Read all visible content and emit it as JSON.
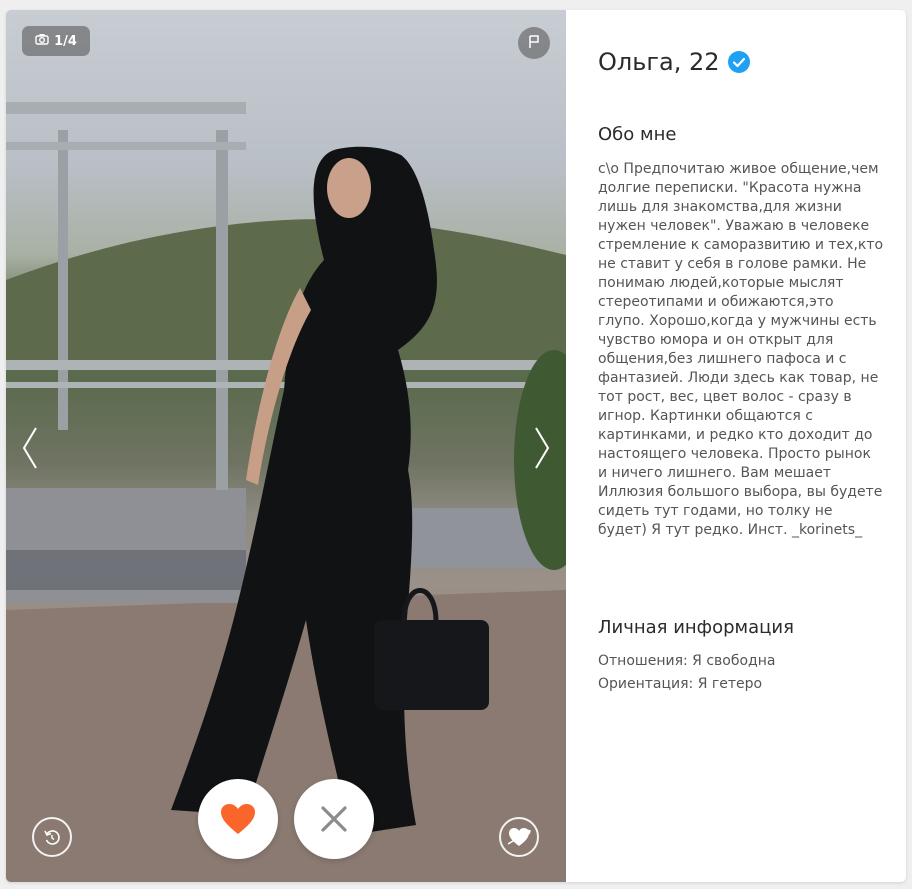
{
  "photo": {
    "counter": "1/4",
    "alt": "Фото профиля"
  },
  "profile": {
    "name_age": "Ольга, 22",
    "verified": true
  },
  "about": {
    "heading": "Обо мне",
    "text": "с\\о Предпочитаю живое общение,чем долгие переписки. \"Красота нужна лишь для знакомства,для жизни нужен человек\". Уважаю в человеке стремление к саморазвитию и тех,кто не ставит у себя в голове рамки. Не понимаю людей,которые мыслят стереотипами и обижаются,это глупо. Хорошо,когда у мужчины есть чувство юмора и он открыт для общения,без лишнего пафоса и с фантазией. Люди здесь как товар, не тот рост, вес, цвет волос - сразу в игнор. Картинки общаются с картинками, и редко кто доходит до настоящего человека. Просто рынок и ничего лишнего. Вам мешает Иллюзия большого выбора, вы будете сидеть тут годами, но толку не будет) Я тут редко. Инст. _korinets_"
  },
  "personal": {
    "heading": "Личная информация",
    "relationship": "Отношения: Я свободна",
    "orientation": "Ориентация: Я гетеро"
  },
  "icons": {
    "camera": "camera-icon",
    "flag": "flag-icon",
    "prev": "chevron-left-icon",
    "next": "chevron-right-icon",
    "undo": "undo-icon",
    "like": "heart-icon",
    "dislike": "close-icon",
    "superlike": "heart-arrow-icon",
    "verified": "verified-check-icon"
  },
  "colors": {
    "like": "#f9652a",
    "dislike": "#8c8c8c",
    "verified": "#1ea1f2"
  }
}
